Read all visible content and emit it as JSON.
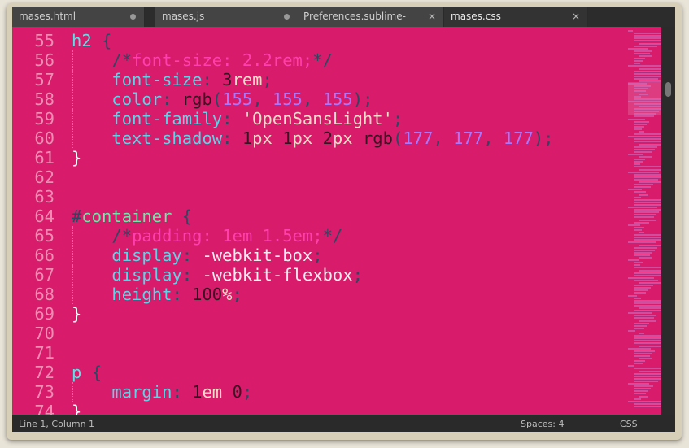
{
  "tabs": [
    {
      "label": "mases.html",
      "state": "modified",
      "active": false
    },
    {
      "label": "mases.js",
      "state": "modified",
      "active": false
    },
    {
      "label": "Preferences.sublime-settings",
      "state": "close",
      "active": false
    },
    {
      "label": "mases.css",
      "state": "close",
      "active": true
    }
  ],
  "close_glyph": "×",
  "colors": {
    "editor_bg": "#d81b6b",
    "line_number": "#f08cb4",
    "property": "#5fd2e6",
    "comment": "#ff3fae",
    "number_in_rgb": "#a877ff"
  },
  "lines": [
    {
      "n": "55",
      "tokens": [
        [
          "h2",
          "sel"
        ],
        [
          " ",
          ""
        ],
        [
          "{",
          "pun"
        ]
      ]
    },
    {
      "n": "56",
      "tokens": [
        [
          "    ",
          ""
        ],
        [
          "/*",
          "pun"
        ],
        [
          "font-size: 2.2rem;",
          "cm"
        ],
        [
          "*/",
          "pun"
        ]
      ]
    },
    {
      "n": "57",
      "tokens": [
        [
          "    ",
          ""
        ],
        [
          "font-size",
          "prop"
        ],
        [
          ": ",
          "pun"
        ],
        [
          "3",
          "num"
        ],
        [
          "rem",
          "unit"
        ],
        [
          ";",
          "pun"
        ]
      ]
    },
    {
      "n": "58",
      "tokens": [
        [
          "    ",
          ""
        ],
        [
          "color",
          "prop"
        ],
        [
          ": ",
          "pun"
        ],
        [
          "rgb",
          "fn"
        ],
        [
          "(",
          "pun"
        ],
        [
          "155",
          "rgbn"
        ],
        [
          ", ",
          "pun"
        ],
        [
          "155",
          "rgbn"
        ],
        [
          ", ",
          "pun"
        ],
        [
          "155",
          "rgbn"
        ],
        [
          ");",
          "pun"
        ]
      ]
    },
    {
      "n": "59",
      "tokens": [
        [
          "    ",
          ""
        ],
        [
          "font-family",
          "prop"
        ],
        [
          ": ",
          "pun"
        ],
        [
          "'OpenSansLight'",
          "str"
        ],
        [
          ";",
          "pun"
        ]
      ]
    },
    {
      "n": "60",
      "tokens": [
        [
          "    ",
          ""
        ],
        [
          "text-shadow",
          "prop"
        ],
        [
          ": ",
          "pun"
        ],
        [
          "1",
          "num"
        ],
        [
          "px ",
          "unit"
        ],
        [
          "1",
          "num"
        ],
        [
          "px ",
          "unit"
        ],
        [
          "2",
          "num"
        ],
        [
          "px ",
          "unit"
        ],
        [
          "rgb",
          "fn"
        ],
        [
          "(",
          "pun"
        ],
        [
          "177",
          "rgbn"
        ],
        [
          ", ",
          "pun"
        ],
        [
          "177",
          "rgbn"
        ],
        [
          ", ",
          "pun"
        ],
        [
          "177",
          "rgbn"
        ],
        [
          ");",
          "pun"
        ]
      ]
    },
    {
      "n": "61",
      "tokens": [
        [
          "}",
          "brace"
        ]
      ]
    },
    {
      "n": "62",
      "tokens": []
    },
    {
      "n": "63",
      "tokens": []
    },
    {
      "n": "64",
      "tokens": [
        [
          "#",
          "pun"
        ],
        [
          "container",
          "id"
        ],
        [
          " ",
          ""
        ],
        [
          "{",
          "pun"
        ]
      ]
    },
    {
      "n": "65",
      "tokens": [
        [
          "    ",
          ""
        ],
        [
          "/*",
          "pun"
        ],
        [
          "padding: 1em 1.5em;",
          "cm"
        ],
        [
          "*/",
          "pun"
        ]
      ]
    },
    {
      "n": "66",
      "tokens": [
        [
          "    ",
          ""
        ],
        [
          "display",
          "prop"
        ],
        [
          ": ",
          "pun"
        ],
        [
          "-webkit-box",
          "val"
        ],
        [
          ";",
          "pun"
        ]
      ]
    },
    {
      "n": "67",
      "tokens": [
        [
          "    ",
          ""
        ],
        [
          "display",
          "prop"
        ],
        [
          ": ",
          "pun"
        ],
        [
          "-webkit-flexbox",
          "val"
        ],
        [
          ";",
          "pun"
        ]
      ]
    },
    {
      "n": "68",
      "tokens": [
        [
          "    ",
          ""
        ],
        [
          "height",
          "prop"
        ],
        [
          ": ",
          "pun"
        ],
        [
          "100",
          "num"
        ],
        [
          "%",
          "unit"
        ],
        [
          ";",
          "pun"
        ]
      ]
    },
    {
      "n": "69",
      "tokens": [
        [
          "}",
          "brace"
        ]
      ]
    },
    {
      "n": "70",
      "tokens": []
    },
    {
      "n": "71",
      "tokens": []
    },
    {
      "n": "72",
      "tokens": [
        [
          "p",
          "sel"
        ],
        [
          " ",
          ""
        ],
        [
          "{",
          "pun"
        ]
      ]
    },
    {
      "n": "73",
      "tokens": [
        [
          "    ",
          ""
        ],
        [
          "margin",
          "prop"
        ],
        [
          ": ",
          "pun"
        ],
        [
          "1",
          "num"
        ],
        [
          "em ",
          "unit"
        ],
        [
          "0",
          "num"
        ],
        [
          ";",
          "pun"
        ]
      ]
    },
    {
      "n": "74",
      "tokens": [
        [
          "}",
          "brace"
        ]
      ]
    }
  ],
  "status": {
    "position": "Line 1, Column 1",
    "indentation": "Spaces: 4",
    "syntax": "CSS"
  }
}
